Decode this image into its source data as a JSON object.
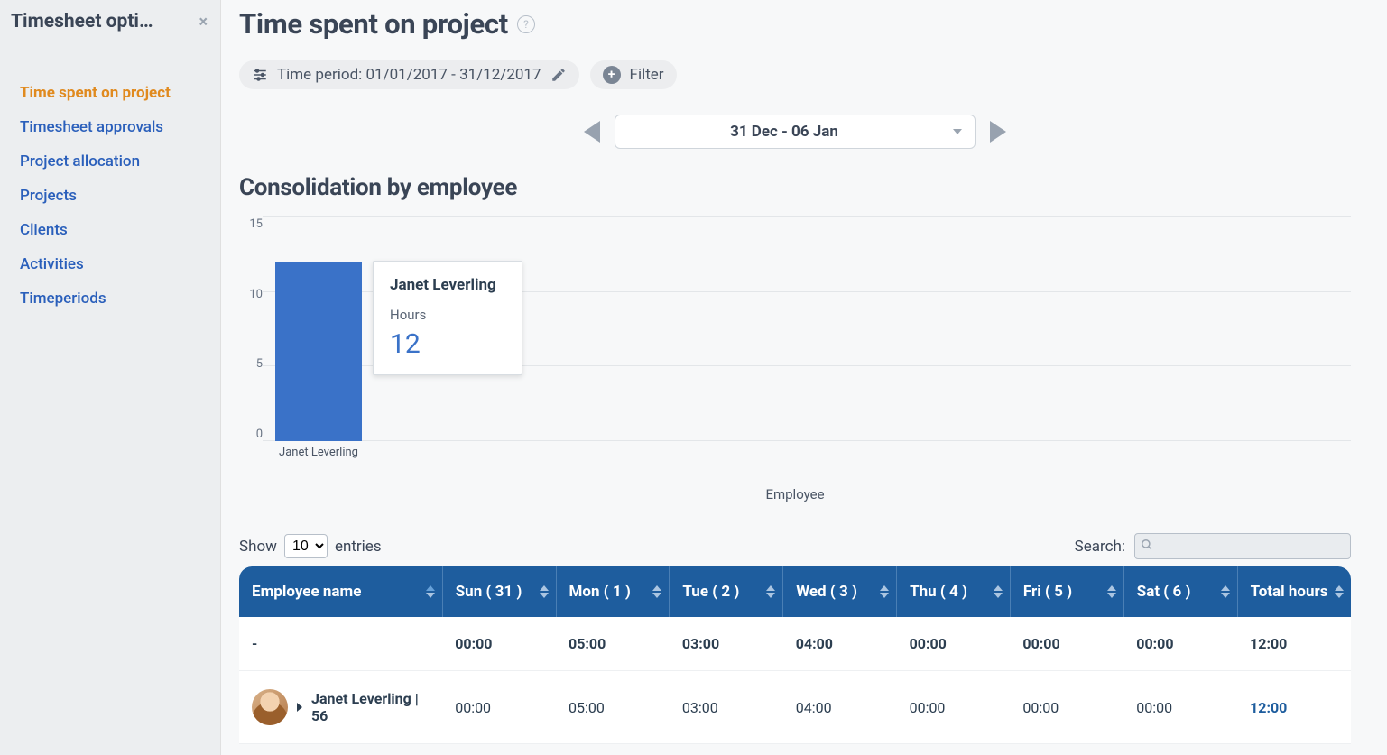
{
  "sidebar": {
    "title": "Timesheet opti…",
    "items": [
      {
        "label": "Time spent on project",
        "active": true
      },
      {
        "label": "Timesheet approvals",
        "active": false
      },
      {
        "label": "Project allocation",
        "active": false
      },
      {
        "label": "Projects",
        "active": false
      },
      {
        "label": "Clients",
        "active": false
      },
      {
        "label": "Activities",
        "active": false
      },
      {
        "label": "Timeperiods",
        "active": false
      }
    ]
  },
  "header": {
    "page_title": "Time spent on project",
    "help_tooltip": "?",
    "time_period_chip": "Time period: 01/01/2017 - 31/12/2017",
    "filter_label": "Filter",
    "date_range": "31 Dec - 06 Jan"
  },
  "chart_section_title": "Consolidation by employee",
  "chart_data": {
    "type": "bar",
    "categories": [
      "Janet Leverling"
    ],
    "values": [
      12
    ],
    "ylabel": "",
    "xlabel": "Employee",
    "ylim": [
      0,
      15
    ],
    "yticks": [
      0,
      5,
      10,
      15
    ]
  },
  "tooltip": {
    "name": "Janet Leverling",
    "metric_label": "Hours",
    "metric_value": "12"
  },
  "table_controls": {
    "show_label_pre": "Show",
    "show_label_post": "entries",
    "show_value": "10",
    "search_label": "Search:",
    "search_value": ""
  },
  "table": {
    "columns": [
      "Employee name",
      "Sun ( 31 )",
      "Mon ( 1 )",
      "Tue ( 2 )",
      "Wed ( 3 )",
      "Thu ( 4 )",
      "Fri ( 5 )",
      "Sat ( 6 )",
      "Total hours"
    ],
    "column_widths": [
      "17%",
      "9.5%",
      "9.5%",
      "9.5%",
      "9.5%",
      "9.5%",
      "9.5%",
      "9.5%",
      "9.5%"
    ],
    "rows": [
      {
        "type": "totals",
        "cells": [
          "-",
          "00:00",
          "05:00",
          "03:00",
          "04:00",
          "00:00",
          "00:00",
          "00:00",
          "12:00"
        ]
      },
      {
        "type": "employee",
        "name": "Janet Leverling | 56",
        "cells": [
          "",
          "00:00",
          "05:00",
          "03:00",
          "04:00",
          "00:00",
          "00:00",
          "00:00",
          "12:00"
        ]
      }
    ]
  }
}
